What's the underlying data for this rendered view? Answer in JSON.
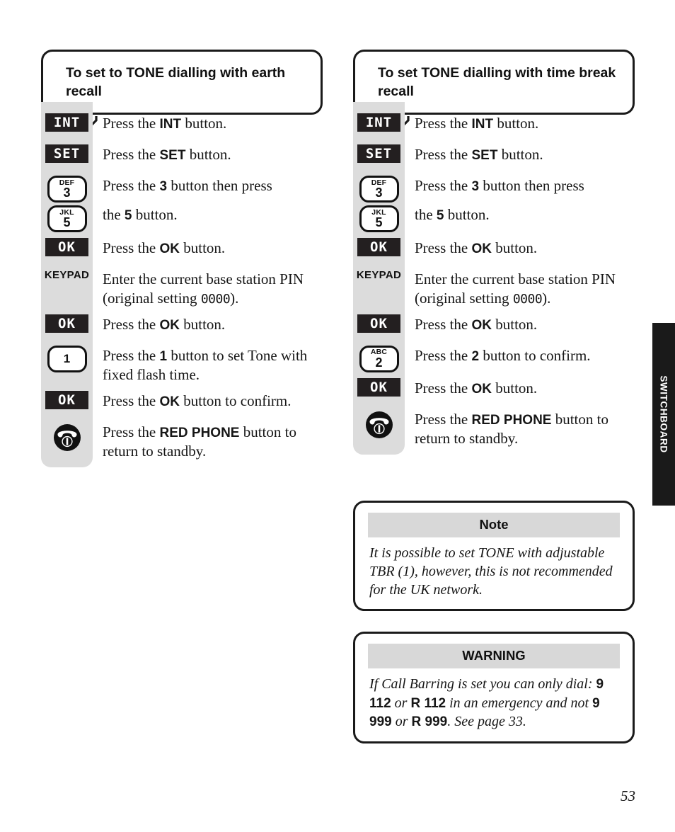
{
  "page": {
    "number": "53",
    "side_tab_label": "SWITCHBOARD"
  },
  "columns": [
    {
      "id": "left",
      "title": "To set to TONE dialling with earth recall",
      "steps": [
        {
          "icon": "int-key-icon",
          "icon_type": "dark",
          "icon_label": "INT",
          "text_html": "Press the <b>INT</b> button."
        },
        {
          "icon": "set-key-icon",
          "icon_type": "dark",
          "icon_label": "SET",
          "text_html": "Press the <b>SET</b> button."
        },
        {
          "icon": "keypad-3-icon",
          "icon_type": "numpad",
          "letters": "DEF",
          "digit": "3",
          "text_html": "Press the <b>3</b> button then press"
        },
        {
          "icon": "keypad-5-icon",
          "icon_type": "numpad",
          "letters": "JKL",
          "digit": "5",
          "text_html": "the <b>5</b> button."
        },
        {
          "icon": "ok-key-icon",
          "icon_type": "dark",
          "icon_label": "OK",
          "text_html": "Press the <b>OK</b> button."
        },
        {
          "icon": "keypad-label-icon",
          "icon_type": "text",
          "icon_label": "KEYPAD",
          "text_html": "Enter the current base station PIN (original setting <span class=\"mono\">0000</span>)."
        },
        {
          "icon": "ok-key-icon",
          "icon_type": "dark",
          "icon_label": "OK",
          "text_html": "Press the <b>OK</b> button."
        },
        {
          "icon": "keypad-1-icon",
          "icon_type": "numpad",
          "letters": "",
          "digit": "1",
          "text_html": "Press the <b>1</b> button to set Tone with fixed flash time."
        },
        {
          "icon": "ok-key-icon",
          "icon_type": "dark",
          "icon_label": "OK",
          "text_html": "Press the <b>OK</b> button to confirm."
        },
        {
          "icon": "red-phone-icon",
          "icon_type": "phone",
          "text_html": "Press the <b>RED PHONE</b> button to return to standby."
        }
      ]
    },
    {
      "id": "right",
      "title": "To set TONE dialling with time break recall",
      "steps": [
        {
          "icon": "int-key-icon",
          "icon_type": "dark",
          "icon_label": "INT",
          "text_html": "Press the <b>INT</b> button."
        },
        {
          "icon": "set-key-icon",
          "icon_type": "dark",
          "icon_label": "SET",
          "text_html": "Press the <b>SET</b> button."
        },
        {
          "icon": "keypad-3-icon",
          "icon_type": "numpad",
          "letters": "DEF",
          "digit": "3",
          "text_html": "Press the <b>3</b> button then press"
        },
        {
          "icon": "keypad-5-icon",
          "icon_type": "numpad",
          "letters": "JKL",
          "digit": "5",
          "text_html": "the <b>5</b> button."
        },
        {
          "icon": "ok-key-icon",
          "icon_type": "dark",
          "icon_label": "OK",
          "text_html": "Press the <b>OK</b> button."
        },
        {
          "icon": "keypad-label-icon",
          "icon_type": "text",
          "icon_label": "KEYPAD",
          "text_html": "Enter the current base station PIN (original setting <span class=\"mono\">0000</span>)."
        },
        {
          "icon": "ok-key-icon",
          "icon_type": "dark",
          "icon_label": "OK",
          "text_html": "Press the <b>OK</b> button."
        },
        {
          "icon": "keypad-2-icon",
          "icon_type": "numpad",
          "letters": "ABC",
          "digit": "2",
          "text_html": "Press the <b>2</b> button to confirm."
        },
        {
          "icon": "ok-key-icon",
          "icon_type": "dark",
          "icon_label": "OK",
          "text_html": "Press the <b>OK</b> button."
        },
        {
          "icon": "red-phone-icon",
          "icon_type": "phone",
          "text_html": "Press the <b>RED PHONE</b> button to return to standby."
        }
      ]
    }
  ],
  "note_box": {
    "heading": "Note",
    "body_html": "It is possible to set TONE with adjustable TBR (1), however, this is not recommended for the UK network."
  },
  "warning_box": {
    "heading": "WARNING",
    "body_html": "If Call Barring is set you can only dial: <b>9 112</b> <i>or</i> <b>R 112</b> in an emergency and not <b>9 999</b> <i>or</i> <b>R 999</b>. See page 33."
  },
  "colors": {
    "ink": "#1a1a1a",
    "strip_grey": "#dcdcdc",
    "box_head_grey": "#d8d8d8",
    "tab_black": "#1a1a1a"
  }
}
